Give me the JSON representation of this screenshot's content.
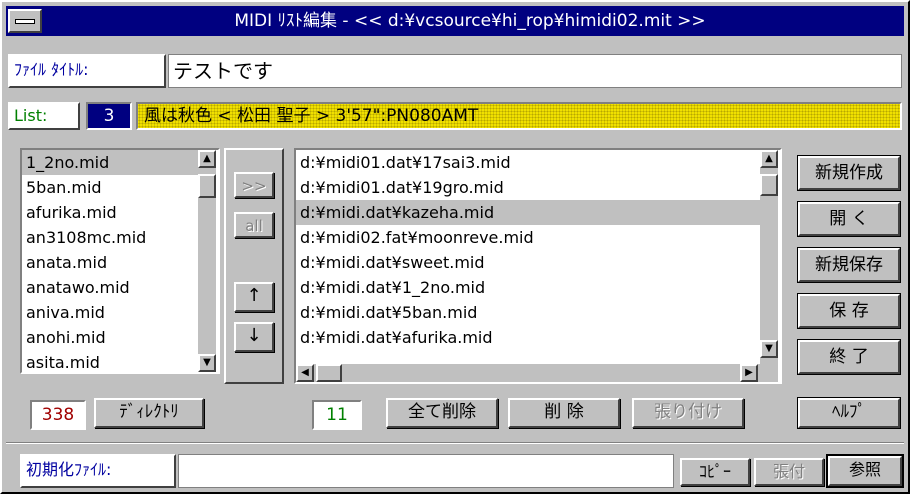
{
  "window": {
    "title": "MIDI ﾘｽﾄ編集 - << d:¥vcsource¥hi_rop¥himidi02.mit >>"
  },
  "file_title": {
    "label": "ﾌｧｲﾙ ﾀｲﾄﾙ:",
    "value": "テストです"
  },
  "list_info": {
    "label": "List:",
    "index": "3",
    "entry": "風は秋色 < 松田 聖子 > 3'57\":PN080AMT"
  },
  "left_list": {
    "items": [
      "1_2no.mid",
      "5ban.mid",
      "afurika.mid",
      "an3108mc.mid",
      "anata.mid",
      "anatawo.mid",
      "aniva.mid",
      "anohi.mid",
      "asita.mid"
    ],
    "selected_index": 0,
    "count": "338",
    "dir_button": "ﾃﾞｨﾚｸﾄﾘ"
  },
  "mid_buttons": {
    "add": ">>",
    "all": "all",
    "up": "↑",
    "down": "↓"
  },
  "right_list": {
    "items": [
      "d:¥midi01.dat¥17sai3.mid",
      "d:¥midi01.dat¥19gro.mid",
      "d:¥midi.dat¥kazeha.mid",
      "d:¥midi02.fat¥moonreve.mid",
      "d:¥midi.dat¥sweet.mid",
      "d:¥midi.dat¥1_2no.mid",
      "d:¥midi.dat¥5ban.mid",
      "d:¥midi.dat¥afurika.mid"
    ],
    "selected_index": 2,
    "count": "11"
  },
  "actions": {
    "delete_all": "全て削除",
    "delete": "削 除",
    "paste": "張り付け"
  },
  "side_buttons": {
    "new": "新規作成",
    "open": "開 く",
    "new_save": "新規保存",
    "save": "保 存",
    "exit": "終 了",
    "help": "ﾍﾙﾌﾟ"
  },
  "init_file": {
    "label": "初期化ﾌｧｲﾙ:",
    "value": "",
    "copy": "ｺﾋﾟｰ",
    "paste": "張付",
    "browse": "参照"
  },
  "colors": {
    "title_bar": "#000080",
    "face": "#c0c0c0",
    "label_blue": "#0000a0",
    "list_bar": "#f0e000",
    "count_red": "#a00000",
    "count_green": "#008000"
  }
}
